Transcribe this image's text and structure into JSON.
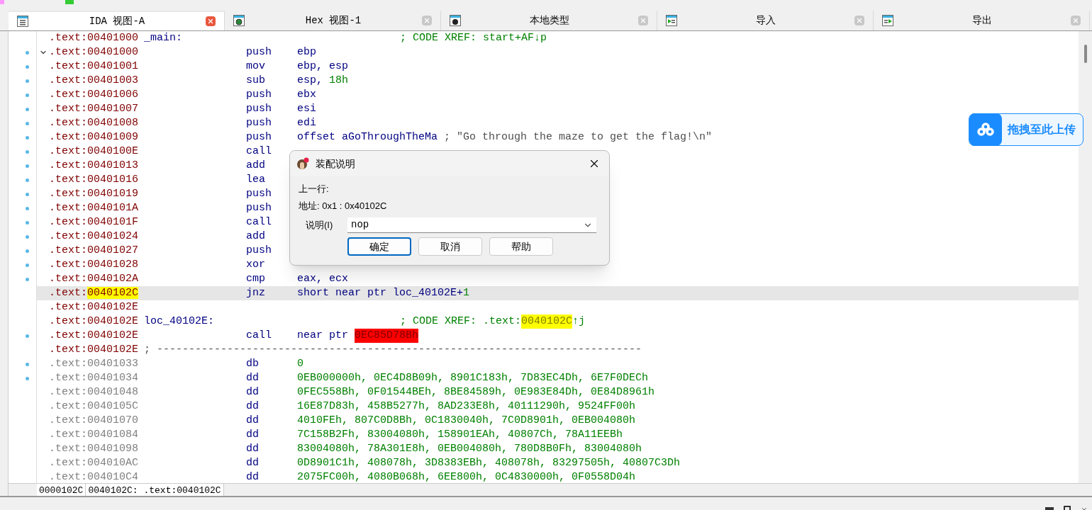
{
  "tabs": [
    {
      "label": "IDA 视图-A",
      "selected": true
    },
    {
      "label": "Hex 视图-1",
      "selected": false
    },
    {
      "label": "本地类型",
      "selected": false
    },
    {
      "label": "导入",
      "selected": false
    },
    {
      "label": "导出",
      "selected": false
    }
  ],
  "listing": [
    {
      "segment": ".text:",
      "address": "00401000",
      "dim": false,
      "dot": false,
      "fold": false,
      "current": false,
      "highlight": false,
      "label": "_main:",
      "comment": [
        {
          "t": "; CODE XREF: start+AF↓p",
          "kind": "number"
        }
      ]
    },
    {
      "segment": ".text:",
      "address": "00401000",
      "dim": false,
      "dot": true,
      "fold": true,
      "current": false,
      "highlight": false,
      "mnem": "push",
      "ops": [
        {
          "t": "ebp",
          "kind": "operand"
        }
      ]
    },
    {
      "segment": ".text:",
      "address": "00401001",
      "dim": false,
      "dot": true,
      "fold": false,
      "current": false,
      "highlight": false,
      "mnem": "mov",
      "ops": [
        {
          "t": "ebp, esp",
          "kind": "operand"
        }
      ]
    },
    {
      "segment": ".text:",
      "address": "00401003",
      "dim": false,
      "dot": true,
      "fold": false,
      "current": false,
      "highlight": false,
      "mnem": "sub",
      "ops": [
        {
          "t": "esp, ",
          "kind": "operand"
        },
        {
          "t": "18h",
          "kind": "number"
        }
      ]
    },
    {
      "segment": ".text:",
      "address": "00401006",
      "dim": false,
      "dot": true,
      "fold": false,
      "current": false,
      "highlight": false,
      "mnem": "push",
      "ops": [
        {
          "t": "ebx",
          "kind": "operand"
        }
      ]
    },
    {
      "segment": ".text:",
      "address": "00401007",
      "dim": false,
      "dot": true,
      "fold": false,
      "current": false,
      "highlight": false,
      "mnem": "push",
      "ops": [
        {
          "t": "esi",
          "kind": "operand"
        }
      ]
    },
    {
      "segment": ".text:",
      "address": "00401008",
      "dim": false,
      "dot": true,
      "fold": false,
      "current": false,
      "highlight": false,
      "mnem": "push",
      "ops": [
        {
          "t": "edi",
          "kind": "operand"
        }
      ]
    },
    {
      "segment": ".text:",
      "address": "00401009",
      "dim": false,
      "dot": true,
      "fold": false,
      "current": false,
      "highlight": false,
      "mnem": "push",
      "ops": [
        {
          "t": "offset aGoThroughTheMa",
          "kind": "operand"
        },
        {
          "t": " ; \"Go through the maze to get the flag!\\n\"",
          "kind": "string"
        }
      ]
    },
    {
      "segment": ".text:",
      "address": "0040100E",
      "dim": false,
      "dot": true,
      "fold": false,
      "current": false,
      "highlight": false,
      "mnem": "call"
    },
    {
      "segment": ".text:",
      "address": "00401013",
      "dim": false,
      "dot": true,
      "fold": false,
      "current": false,
      "highlight": false,
      "mnem": "add"
    },
    {
      "segment": ".text:",
      "address": "00401016",
      "dim": false,
      "dot": true,
      "fold": false,
      "current": false,
      "highlight": false,
      "mnem": "lea"
    },
    {
      "segment": ".text:",
      "address": "00401019",
      "dim": false,
      "dot": true,
      "fold": false,
      "current": false,
      "highlight": false,
      "mnem": "push"
    },
    {
      "segment": ".text:",
      "address": "0040101A",
      "dim": false,
      "dot": true,
      "fold": false,
      "current": false,
      "highlight": false,
      "mnem": "push"
    },
    {
      "segment": ".text:",
      "address": "0040101F",
      "dim": false,
      "dot": true,
      "fold": false,
      "current": false,
      "highlight": false,
      "mnem": "call"
    },
    {
      "segment": ".text:",
      "address": "00401024",
      "dim": false,
      "dot": true,
      "fold": false,
      "current": false,
      "highlight": false,
      "mnem": "add"
    },
    {
      "segment": ".text:",
      "address": "00401027",
      "dim": false,
      "dot": true,
      "fold": false,
      "current": false,
      "highlight": false,
      "mnem": "push"
    },
    {
      "segment": ".text:",
      "address": "00401028",
      "dim": false,
      "dot": true,
      "fold": false,
      "current": false,
      "highlight": false,
      "mnem": "xor"
    },
    {
      "segment": ".text:",
      "address": "0040102A",
      "dim": false,
      "dot": true,
      "fold": false,
      "current": false,
      "highlight": false,
      "mnem": "cmp",
      "ops": [
        {
          "t": "eax, ecx",
          "kind": "operand"
        }
      ]
    },
    {
      "segment": ".text:",
      "address": "0040102C",
      "dim": false,
      "dot": false,
      "fold": false,
      "current": true,
      "highlight": true,
      "mnem": "jnz",
      "ops": [
        {
          "t": "short near ptr loc_40102E+",
          "kind": "operand"
        },
        {
          "t": "1",
          "kind": "number"
        }
      ]
    },
    {
      "segment": ".text:",
      "address": "0040102E",
      "dim": false,
      "dot": false,
      "fold": false,
      "current": false,
      "highlight": false
    },
    {
      "segment": ".text:",
      "address": "0040102E",
      "dim": false,
      "dot": false,
      "fold": false,
      "current": false,
      "highlight": false,
      "label": "loc_40102E:",
      "comment": [
        {
          "t": "; CODE XREF: .text:",
          "kind": "number"
        },
        {
          "t": "0040102C",
          "kind": "xref"
        },
        {
          "t": "↑j",
          "kind": "number"
        }
      ]
    },
    {
      "segment": ".text:",
      "address": "0040102E",
      "dim": false,
      "dot": true,
      "fold": false,
      "current": false,
      "highlight": false,
      "mnem": "call",
      "ops": [
        {
          "t": "near ptr ",
          "kind": "operand"
        },
        {
          "t": "0EC85D78Bh",
          "kind": "bad"
        }
      ]
    },
    {
      "segment": ".text:",
      "address": "0040102E",
      "dim": false,
      "dot": false,
      "fold": false,
      "current": false,
      "highlight": false,
      "separator": "; ----------------------------------------------------------------------------"
    },
    {
      "segment": ".text:",
      "address": "00401033",
      "dim": true,
      "dot": true,
      "fold": false,
      "current": false,
      "highlight": false,
      "mnem": "db",
      "ops": [
        {
          "t": "0",
          "kind": "number"
        }
      ]
    },
    {
      "segment": ".text:",
      "address": "00401034",
      "dim": true,
      "dot": true,
      "fold": false,
      "current": false,
      "highlight": false,
      "mnem": "dd",
      "ops": [
        {
          "t": "0EB000000h, 0EC4D8B09h, 8901C183h, 7D83EC4Dh, 6E7F0DECh",
          "kind": "number"
        }
      ]
    },
    {
      "segment": ".text:",
      "address": "00401048",
      "dim": true,
      "dot": false,
      "fold": false,
      "current": false,
      "highlight": false,
      "mnem": "dd",
      "ops": [
        {
          "t": "0FEC558Bh, 0F01544BEh, 8BE84589h, 0E983E84Dh, 0E84D8961h",
          "kind": "number"
        }
      ]
    },
    {
      "segment": ".text:",
      "address": "0040105C",
      "dim": true,
      "dot": false,
      "fold": false,
      "current": false,
      "highlight": false,
      "mnem": "dd",
      "ops": [
        {
          "t": "16E87D83h, 458B5277h, 8AD233E8h, 40111290h, 9524FF00h",
          "kind": "number"
        }
      ]
    },
    {
      "segment": ".text:",
      "address": "00401070",
      "dim": true,
      "dot": false,
      "fold": false,
      "current": false,
      "highlight": false,
      "mnem": "dd",
      "ops": [
        {
          "t": "4010FEh, 807C0D8Bh, 0C1830040h, 7C0D8901h, 0EB004080h",
          "kind": "number"
        }
      ]
    },
    {
      "segment": ".text:",
      "address": "00401084",
      "dim": true,
      "dot": false,
      "fold": false,
      "current": false,
      "highlight": false,
      "mnem": "dd",
      "ops": [
        {
          "t": "7C158B2Fh, 83004080h, 158901EAh, 40807Ch, 78A11EEBh",
          "kind": "number"
        }
      ]
    },
    {
      "segment": ".text:",
      "address": "00401098",
      "dim": true,
      "dot": false,
      "fold": false,
      "current": false,
      "highlight": false,
      "mnem": "dd",
      "ops": [
        {
          "t": "83004080h, 78A301E8h, 0EB004080h, 780D8B0Fh, 83004080h",
          "kind": "number"
        }
      ]
    },
    {
      "segment": ".text:",
      "address": "004010AC",
      "dim": true,
      "dot": false,
      "fold": false,
      "current": false,
      "highlight": false,
      "mnem": "dd",
      "ops": [
        {
          "t": "0D8901C1h, 408078h, 3D8383EBh, 408078h, 83297505h, 40807C3Dh",
          "kind": "number"
        }
      ]
    },
    {
      "segment": ".text:",
      "address": "004010C4",
      "dim": true,
      "dot": false,
      "fold": false,
      "current": false,
      "highlight": false,
      "mnem": "dd",
      "ops": [
        {
          "t": "2075FC00h, 4080B068h, 6EE800h, 0C4830000h, 0F0558D04h",
          "kind": "number"
        }
      ]
    }
  ],
  "dialog": {
    "title": "装配说明",
    "lines": [
      "上一行:",
      "地址: 0x1 : 0x40102C"
    ],
    "field_label": "说明(I)",
    "field_value": "nop",
    "buttons": [
      {
        "label": "确定",
        "default": true
      },
      {
        "label": "取消",
        "default": false
      },
      {
        "label": "帮助",
        "default": false
      }
    ]
  },
  "upload_widget": {
    "label": "拖拽至此上传"
  },
  "status_bar": [
    "0000102C",
    "0040102C: .text:0040102C"
  ]
}
